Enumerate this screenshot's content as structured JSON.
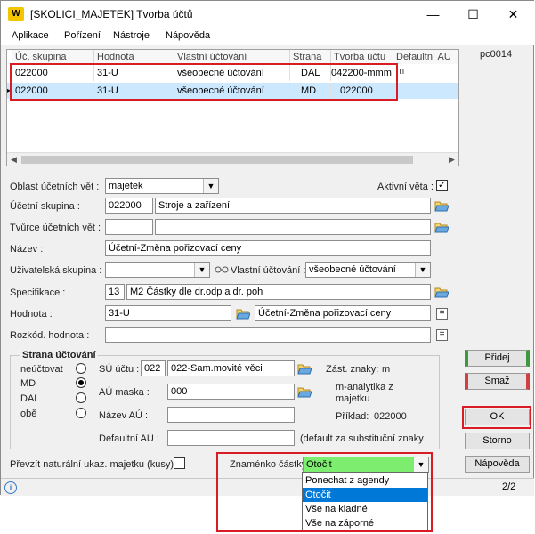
{
  "window": {
    "logo": "W",
    "title": "[SKOLICI_MAJETEK] Tvorba účtů",
    "minimize": "—",
    "maximize": "☐",
    "close": "✕"
  },
  "menu": [
    "Aplikace",
    "Pořízení",
    "Nástroje",
    "Nápověda"
  ],
  "pc_label": "pc0014",
  "grid": {
    "columns": [
      "Úč. skupina",
      "Hodnota",
      "Vlastní účtování",
      "Strana",
      "Tvorba účtu",
      "Defaultní AU m"
    ],
    "rows": [
      [
        "022000",
        "31-U",
        "všeobecné účtování",
        "DAL",
        "042200-mmm",
        ""
      ],
      [
        "022000",
        "31-U",
        "všeobecné účtování",
        "MD",
        "022000",
        ""
      ]
    ]
  },
  "form": {
    "oblast_label": "Oblast účetních vět :",
    "oblast_value": "majetek",
    "aktivni_label": "Aktivní věta :",
    "aktivni_checked": "✓",
    "ucetni_skupina_label": "Účetní skupina :",
    "ucetni_skupina_code": "022000",
    "ucetni_skupina_name": "Stroje a zařízení",
    "tvurce_label": "Tvůrce účetních vět :",
    "nazev_label": "Název :",
    "nazev_value": "Účetní-Změna pořizovací ceny",
    "uziv_skupina_label": "Uživatelská skupina :",
    "vlastni_ucetovani_label": "Vlastní účtování :",
    "vlastni_ucetovani_value": "všeobecné účtování",
    "specifikace_label": "Specifikace :",
    "specifikace_code": "13",
    "specifikace_value": "M2 Částky dle dr.odp a dr. poh",
    "hodnota_label": "Hodnota :",
    "hodnota_code": "31-U",
    "hodnota_value": "Účetní-Změna pořizovací ceny",
    "rozkod_label": "Rozkód. hodnota :",
    "equals": "="
  },
  "strana": {
    "title": "Strana účtování",
    "options": [
      "neúčtovat",
      "MD",
      "DAL",
      "obě"
    ],
    "selected_index": 1,
    "su_label": "SÚ účtu :",
    "su_code": "022",
    "su_value": "022-Sam.movité věci",
    "au_maska_label": "AÚ maska :",
    "au_maska_value": "000",
    "nazev_au_label": "Název AÚ :",
    "default_au_label": "Defaultní AÚ :",
    "default_au_note": "(default za substituční znaky",
    "zast_label": "Zást. znaky:",
    "zast_value": "m",
    "zast_desc": "m-analytika z majetku",
    "priklad_label": "Příklad:",
    "priklad_value": "022000"
  },
  "bottom": {
    "prevzit_label": "Převzít naturální ukaz. majetku (kusy)",
    "znamenko_label": "Znaménko částky :",
    "znamenko_value": "Otočit",
    "dropdown_options": [
      "Ponechat z agendy",
      "Otočit",
      "Vše na kladné",
      "Vše na záporné"
    ],
    "dropdown_selected": 1
  },
  "buttons": {
    "pridej": "Přidej",
    "smaz": "Smaž",
    "ok": "OK",
    "storno": "Storno",
    "napoveda": "Nápověda"
  },
  "status": {
    "info_icon": "i",
    "page": "2/2"
  },
  "colors": {
    "selection": "#cce8ff",
    "dropdown_selected": "#0078d7",
    "znamenko_bg": "#7ced6f",
    "highlight_red": "#d81b24",
    "add_green": "#3c9a3c",
    "del_red": "#d04040"
  }
}
